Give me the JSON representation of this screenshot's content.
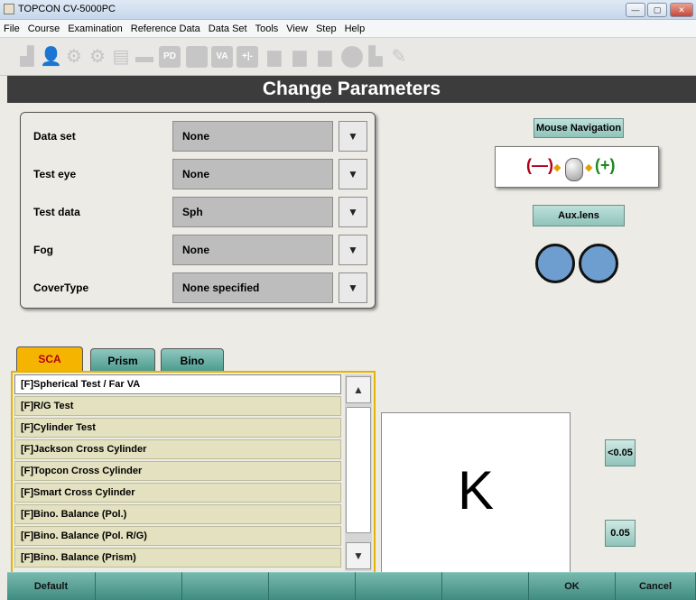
{
  "window": {
    "title": "TOPCON CV-5000PC"
  },
  "menu": [
    "File",
    "Course",
    "Examination",
    "Reference Data",
    "Data Set",
    "Tools",
    "View",
    "Step",
    "Help"
  ],
  "toolbar": {
    "pd_label": "PD",
    "va_label": "VA",
    "plus_label": "+|-"
  },
  "header": {
    "title": "Change Parameters"
  },
  "params": [
    {
      "label": "Data set",
      "value": "None"
    },
    {
      "label": "Test eye",
      "value": "None"
    },
    {
      "label": "Test data",
      "value": "Sph"
    },
    {
      "label": "Fog",
      "value": "None"
    },
    {
      "label": "CoverType",
      "value": "None specified"
    }
  ],
  "right": {
    "mouse_nav_label": "Mouse Navigation",
    "minus": "(—)",
    "plus": "(+)",
    "aux_lens_label": "Aux.lens"
  },
  "tabs": [
    {
      "label": "SCA",
      "active": true
    },
    {
      "label": "Prism",
      "active": false
    },
    {
      "label": "Bino",
      "active": false
    }
  ],
  "tests": [
    "[F]Spherical Test / Far VA",
    "[F]R/G Test",
    "[F]Cylinder Test",
    "[F]Jackson Cross Cylinder",
    "[F]Topcon Cross Cylinder",
    "[F]Smart Cross Cylinder",
    "[F]Bino. Balance (Pol.)",
    "[F]Bino. Balance (Pol. R/G)",
    "[F]Bino. Balance (Prism)"
  ],
  "chart": {
    "letter": "K",
    "va_low": "<0.05",
    "va": "0.05"
  },
  "bottom": {
    "default_label": "Default",
    "ok_label": "OK",
    "cancel_label": "Cancel"
  },
  "colors": {
    "header_bg": "#3c3c3c",
    "tab_active": "#f5b400",
    "teal": "#4e9a8f",
    "lens": "#6d9ecf"
  }
}
